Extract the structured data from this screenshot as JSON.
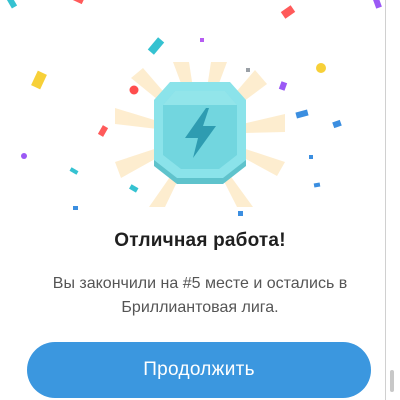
{
  "dialog": {
    "headline": "Отличная работа!",
    "message": "Вы закончили на #5 месте и остались в Бриллиантовая лига.",
    "continue_label": "Продолжить"
  },
  "badge": {
    "icon": "lightning-bolt-icon",
    "league": "diamond",
    "colors": {
      "body": "#7fdde4",
      "body_dark": "#4fc6d0",
      "rim": "#b6eef2",
      "bolt": "#2f9fb3",
      "glow": "#fbe3b4"
    }
  },
  "colors": {
    "accent": "#3b97df",
    "headline": "#1f1f1f",
    "text": "#555555",
    "background": "#ffffff"
  }
}
